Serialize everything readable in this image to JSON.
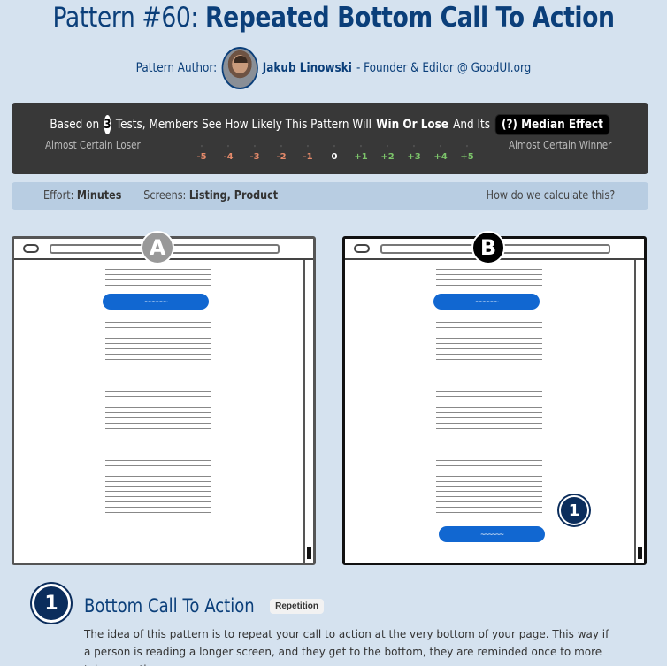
{
  "title": {
    "prefix": "Pattern #60:",
    "name": "Repeated Bottom Call To Action"
  },
  "author": {
    "label": "Pattern Author:",
    "name": "Jakub Linowski",
    "role": "- Founder & Editor @ GoodUI.org"
  },
  "panel": {
    "based_on": "Based on",
    "tests_count": "3",
    "headline_mid": "Tests, Members See How Likely This Pattern Will",
    "win_or_lose": "Win Or Lose",
    "and_its": "And Its",
    "median_button": "(?) Median Effect",
    "left_label": "Almost Certain Loser",
    "right_label": "Almost Certain Winner",
    "scale": [
      {
        "v": "-5",
        "c": "#e58a6a"
      },
      {
        "v": "-4",
        "c": "#e58a6a"
      },
      {
        "v": "-3",
        "c": "#e58a6a"
      },
      {
        "v": "-2",
        "c": "#e58a6a"
      },
      {
        "v": "-1",
        "c": "#e58a6a"
      },
      {
        "v": "0",
        "c": "#ffffff"
      },
      {
        "v": "+1",
        "c": "#7cc46a"
      },
      {
        "v": "+2",
        "c": "#7cc46a"
      },
      {
        "v": "+3",
        "c": "#7cc46a"
      },
      {
        "v": "+4",
        "c": "#7cc46a"
      },
      {
        "v": "+5",
        "c": "#7cc46a"
      }
    ]
  },
  "effort": {
    "effort_label": "Effort:",
    "effort_value": "Minutes",
    "screens_label": "Screens:",
    "screens_value": "Listing, Product",
    "calc_link": "How do we calculate this?"
  },
  "variants": {
    "a": "A",
    "b": "B",
    "marker": "1"
  },
  "feature": {
    "number": "1",
    "title": "Bottom Call To Action",
    "tag": "Repetition",
    "description": "The idea of this pattern is to repeat your call to action at the very bottom of your page. This way if a person is reading a longer screen, and they get to the bottom, they are reminded once to more take an action."
  },
  "colors": {
    "accent": "#0b3f7a",
    "cta": "#1167d1",
    "panel": "#383838",
    "background": "#d5e2ef"
  }
}
